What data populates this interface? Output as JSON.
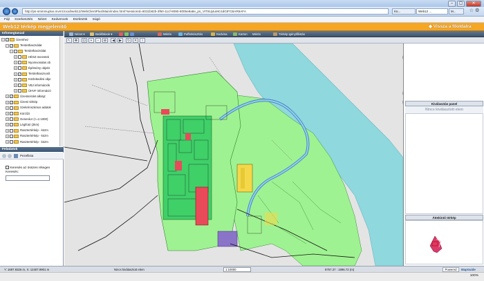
{
  "browser": {
    "url": "http://ps-sminmuplus.mvmt.local/web12/WebClientPlus/Main/index.html?sessionId=8031b82b-3f60-11cf-8090-8005e8a8e_ps_VIT8Uj4uMC4dGtFCBAR8AFA",
    "tabs": [
      "Kü...",
      "Web12 ...",
      "M..."
    ],
    "window_controls": [
      "–",
      "▢",
      "✕"
    ]
  },
  "menu": [
    "Fájl",
    "Szerkesztés",
    "Nézet",
    "Kedvencek",
    "Eszközök",
    "Súgó"
  ],
  "app": {
    "title": "Web12 térkép megjelenítő",
    "back_link": "◆ Vissza a főoldalra"
  },
  "left_panel": {
    "header": "Infomegtanzal",
    "tree": [
      {
        "label": "Üzemhez",
        "level": 0,
        "checked": true,
        "expanded": true
      },
      {
        "label": "Területhasználat",
        "level": 1,
        "checked": true,
        "expanded": true
      },
      {
        "label": "Területhasználat",
        "level": 2,
        "checked": false,
        "expanded": true
      },
      {
        "label": "HÉSZ övezetek",
        "level": 3,
        "checked": false,
        "expanded": false
      },
      {
        "label": "Nyomvonalas ob",
        "level": 3,
        "checked": false,
        "expanded": false
      },
      {
        "label": "Építmény objekt",
        "level": 3,
        "checked": false,
        "expanded": false
      },
      {
        "label": "Területhasznosít",
        "level": 3,
        "checked": true,
        "expanded": false
      },
      {
        "label": "Közlekedési obje",
        "level": 3,
        "checked": false,
        "expanded": false
      },
      {
        "label": "VBJ információk",
        "level": 3,
        "checked": false,
        "expanded": false
      },
      {
        "label": "ÜHVF információ",
        "level": 3,
        "checked": false,
        "expanded": false
      },
      {
        "label": "Üzemterület alkrajz",
        "level": 1,
        "checked": true,
        "expanded": false
      },
      {
        "label": "Üzemi térkép",
        "level": 1,
        "checked": true,
        "expanded": false
      },
      {
        "label": "Szekrénszámos adatok",
        "level": 1,
        "checked": false,
        "expanded": false
      },
      {
        "label": "Körzűzi",
        "level": 1,
        "checked": false,
        "expanded": false
      },
      {
        "label": "Generáor (<=1:1000)",
        "level": 1,
        "checked": false,
        "expanded": false
      },
      {
        "label": "Légifotó (2km)",
        "level": 1,
        "checked": false,
        "expanded": false
      },
      {
        "label": "Rasztertérkép - közm",
        "level": 1,
        "checked": false,
        "expanded": false
      },
      {
        "label": "Rasztertérkép - közm",
        "level": 1,
        "checked": false,
        "expanded": false
      },
      {
        "label": "Rasztertérkép - közm",
        "level": 1,
        "checked": false,
        "expanded": false
      }
    ],
    "tasks_header": "Feladatok",
    "tasks_dropdown": "Pezellista",
    "search_all_label": "Keresés az összes rétegen",
    "search_label": "Keresés:",
    "search_value": ""
  },
  "toolbar": {
    "items": [
      "Nézet",
      "Beállítások",
      "Mérés",
      "Pufferkészítés",
      "Kedvina",
      "Karton",
      "Mérés",
      "Térkép igénylőlistás"
    ]
  },
  "map": {
    "river_color": "#8ed8de",
    "land_color": "#9ff291",
    "plant_color": "#3fd068",
    "highlight_red": "#e84a5a",
    "highlight_purple": "#8a74c8"
  },
  "right_panel": {
    "selection_title": "Kiválasztás panel",
    "selection_empty": "Nincs kiválasztott elem",
    "overview_title": "Áttekintő térkép"
  },
  "status": {
    "coords_left": "Y: 1697.9326 m, X: 12407.9901 m",
    "info": "Nincs kiválasztott elem",
    "scale": "1:10000",
    "coords_right": "8757.37 : 1896.72 (m)",
    "powered_by": "Powered by",
    "brand": "MapGuide"
  },
  "windows_bar": {
    "zoom": "100%"
  }
}
